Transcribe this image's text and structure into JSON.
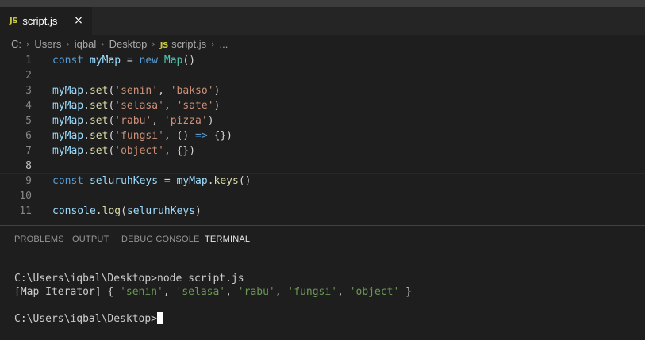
{
  "tab": {
    "badge": "JS",
    "label": "script.js",
    "close": "×"
  },
  "breadcrumb": {
    "items": [
      "C:",
      "Users",
      "iqbal",
      "Desktop",
      "script.js",
      "..."
    ],
    "badge": "JS"
  },
  "editor": {
    "line_numbers": [
      "1",
      "2",
      "3",
      "4",
      "5",
      "6",
      "7",
      "8",
      "9",
      "10",
      "11"
    ],
    "active_line": "8",
    "lines": [
      [
        {
          "t": "kw",
          "v": "const"
        },
        {
          "t": "pn",
          "v": " "
        },
        {
          "t": "var",
          "v": "myMap"
        },
        {
          "t": "pn",
          "v": " = "
        },
        {
          "t": "kw",
          "v": "new"
        },
        {
          "t": "pn",
          "v": " "
        },
        {
          "t": "cls",
          "v": "Map"
        },
        {
          "t": "pn",
          "v": "()"
        }
      ],
      [],
      [
        {
          "t": "var",
          "v": "myMap"
        },
        {
          "t": "pn",
          "v": "."
        },
        {
          "t": "fn",
          "v": "set"
        },
        {
          "t": "pn",
          "v": "("
        },
        {
          "t": "str",
          "v": "'senin'"
        },
        {
          "t": "pn",
          "v": ", "
        },
        {
          "t": "str",
          "v": "'bakso'"
        },
        {
          "t": "pn",
          "v": ")"
        }
      ],
      [
        {
          "t": "var",
          "v": "myMap"
        },
        {
          "t": "pn",
          "v": "."
        },
        {
          "t": "fn",
          "v": "set"
        },
        {
          "t": "pn",
          "v": "("
        },
        {
          "t": "str",
          "v": "'selasa'"
        },
        {
          "t": "pn",
          "v": ", "
        },
        {
          "t": "str",
          "v": "'sate'"
        },
        {
          "t": "pn",
          "v": ")"
        }
      ],
      [
        {
          "t": "var",
          "v": "myMap"
        },
        {
          "t": "pn",
          "v": "."
        },
        {
          "t": "fn",
          "v": "set"
        },
        {
          "t": "pn",
          "v": "("
        },
        {
          "t": "str",
          "v": "'rabu'"
        },
        {
          "t": "pn",
          "v": ", "
        },
        {
          "t": "str",
          "v": "'pizza'"
        },
        {
          "t": "pn",
          "v": ")"
        }
      ],
      [
        {
          "t": "var",
          "v": "myMap"
        },
        {
          "t": "pn",
          "v": "."
        },
        {
          "t": "fn",
          "v": "set"
        },
        {
          "t": "pn",
          "v": "("
        },
        {
          "t": "str",
          "v": "'fungsi'"
        },
        {
          "t": "pn",
          "v": ", () "
        },
        {
          "t": "kw",
          "v": "=>"
        },
        {
          "t": "pn",
          "v": " {})"
        }
      ],
      [
        {
          "t": "var",
          "v": "myMap"
        },
        {
          "t": "pn",
          "v": "."
        },
        {
          "t": "fn",
          "v": "set"
        },
        {
          "t": "pn",
          "v": "("
        },
        {
          "t": "str",
          "v": "'object'"
        },
        {
          "t": "pn",
          "v": ", {})"
        }
      ],
      [],
      [
        {
          "t": "kw",
          "v": "const"
        },
        {
          "t": "pn",
          "v": " "
        },
        {
          "t": "var",
          "v": "seluruhKeys"
        },
        {
          "t": "pn",
          "v": " = "
        },
        {
          "t": "var",
          "v": "myMap"
        },
        {
          "t": "pn",
          "v": "."
        },
        {
          "t": "fn",
          "v": "keys"
        },
        {
          "t": "pn",
          "v": "()"
        }
      ],
      [],
      [
        {
          "t": "var",
          "v": "console"
        },
        {
          "t": "pn",
          "v": "."
        },
        {
          "t": "fn",
          "v": "log"
        },
        {
          "t": "pn",
          "v": "("
        },
        {
          "t": "var",
          "v": "seluruhKeys"
        },
        {
          "t": "pn",
          "v": ")"
        }
      ]
    ]
  },
  "panel": {
    "tabs": [
      "PROBLEMS",
      "OUTPUT",
      "DEBUG CONSOLE",
      "TERMINAL"
    ],
    "active_tab": "TERMINAL"
  },
  "terminal": {
    "command_prompt": "C:\\Users\\iqbal\\Desktop>",
    "command": "node script.js",
    "output_prefix": "[Map Iterator] { ",
    "output_items": [
      "'senin'",
      "'selasa'",
      "'rabu'",
      "'fungsi'",
      "'object'"
    ],
    "output_suffix": " }",
    "prompt": "C:\\Users\\iqbal\\Desktop>"
  },
  "colors": {
    "keyword": "#569cd6",
    "variable": "#9cdcfe",
    "function": "#dcdcaa",
    "class": "#4ec9b0",
    "string": "#ce9178",
    "js_badge": "#cbcb41"
  }
}
